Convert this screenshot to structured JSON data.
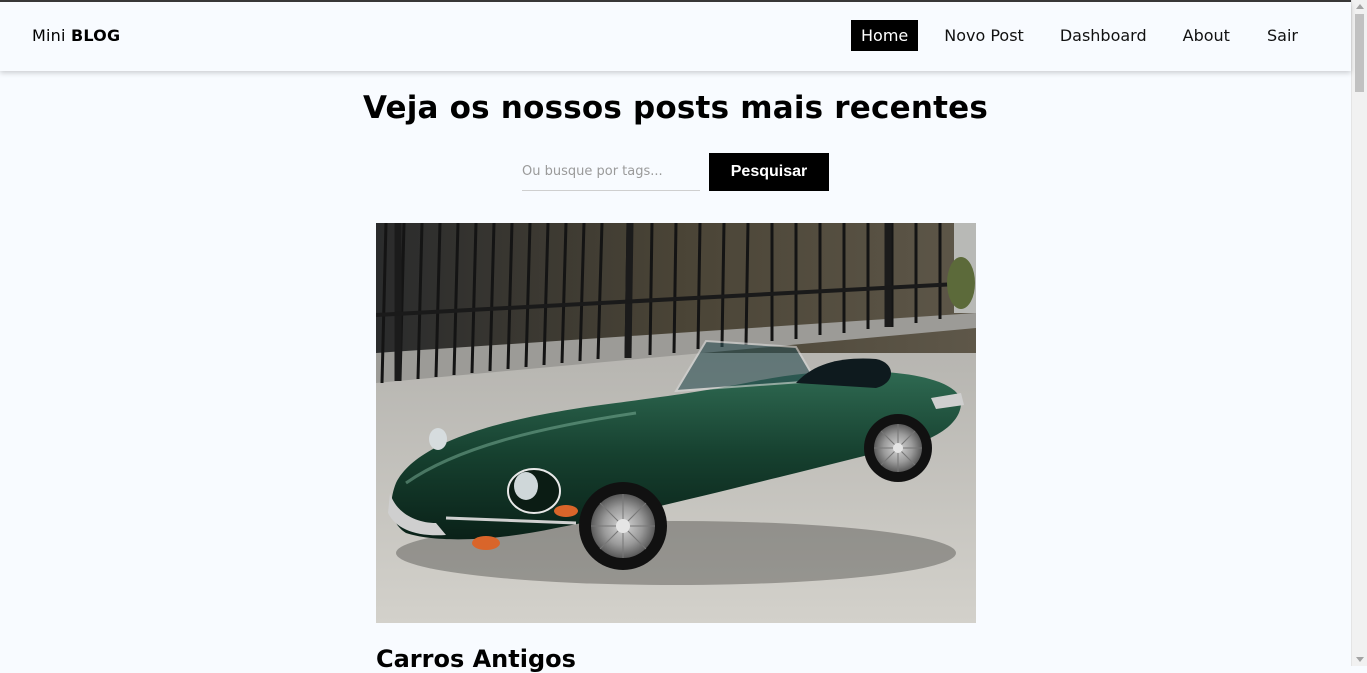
{
  "brand": {
    "prefix": "Mini",
    "bold": "BLOG"
  },
  "nav": {
    "items": [
      {
        "label": "Home",
        "active": true
      },
      {
        "label": "Novo Post"
      },
      {
        "label": "Dashboard"
      },
      {
        "label": "About"
      }
    ],
    "exit_label": "Sair"
  },
  "home": {
    "title": "Veja os nossos posts mais recentes",
    "search": {
      "placeholder": "Ou busque por tags...",
      "value": "",
      "button_label": "Pesquisar"
    }
  },
  "posts": [
    {
      "title": "Carros Antigos",
      "image_icon": "classic-car-photo"
    }
  ],
  "colors": {
    "background": "#f8fbff",
    "accent": "#000000",
    "car": "#16402f"
  }
}
